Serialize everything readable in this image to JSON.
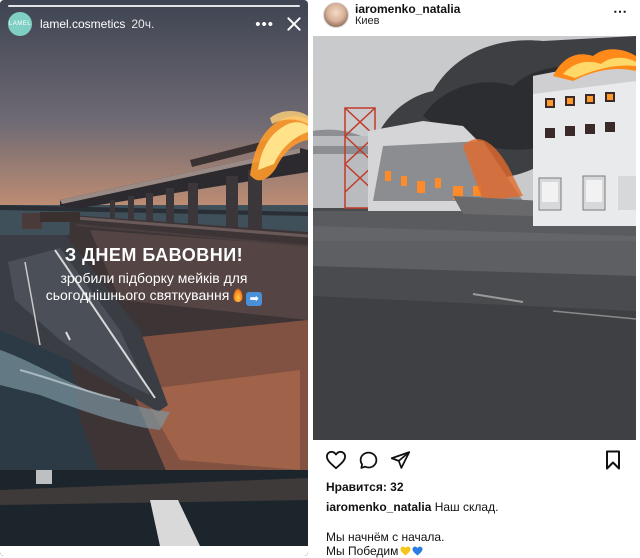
{
  "story": {
    "username": "lamel.cosmetics",
    "avatar_text": "LAMEL",
    "time": "20ч.",
    "menu_icon": "more-horizontal-icon",
    "close_icon": "close-icon",
    "title": "З ДНЕМ БАВОВНИ!",
    "line1": "зробили підборку мейків для",
    "line2": "сьогоднішнього святкування"
  },
  "post": {
    "username": "iaromenko_natalia",
    "location": "Киев",
    "likes": "Нравится: 32",
    "caption_user": "iaromenko_natalia",
    "caption_text": "Наш склад.",
    "line1": "Мы начнём с начала.",
    "line2": "Мы Победим"
  },
  "colors": {
    "heart_yellow": "#f5c518",
    "heart_blue": "#2a7de1"
  }
}
